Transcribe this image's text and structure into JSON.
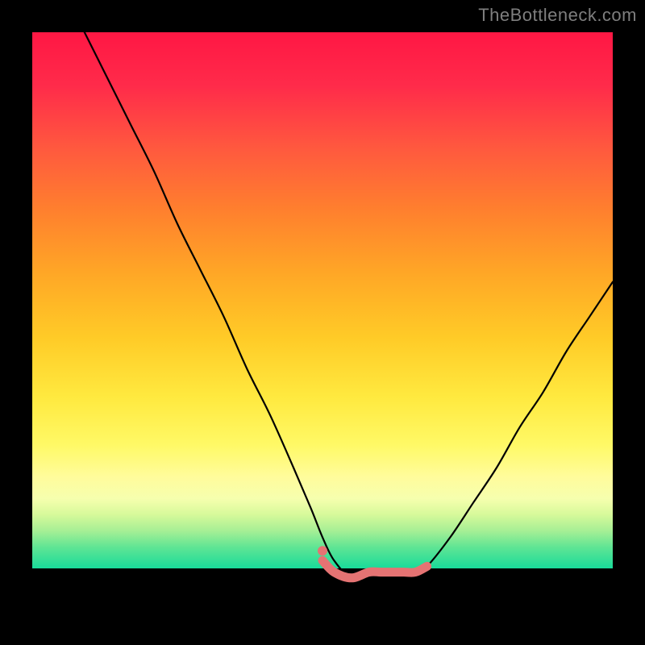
{
  "watermark": "TheBottleneck.com",
  "colors": {
    "frame": "#000000",
    "curve_main": "#000000",
    "curve_accent": "#e57373",
    "watermark": "#7e7e7e"
  },
  "chart_data": {
    "type": "line",
    "title": "",
    "xlabel": "",
    "ylabel": "",
    "xlim": [
      0,
      100
    ],
    "ylim": [
      0,
      100
    ],
    "grid": false,
    "legend": false,
    "note": "No tick labels visible. x/y are in percent of plot width/height (0,0 = bottom-left). Values read off plotted points.",
    "series": [
      {
        "name": "primary-curve",
        "color": "#000000",
        "x": [
          9,
          13,
          17,
          21,
          25,
          29,
          33,
          37,
          41,
          45,
          48,
          50,
          52,
          55,
          58,
          60,
          62,
          64,
          66,
          68,
          72,
          76,
          80,
          84,
          88,
          92,
          96,
          100
        ],
        "y": [
          100,
          92,
          84,
          76,
          67,
          59,
          51,
          42,
          34,
          25,
          18,
          13,
          9,
          6,
          7,
          7,
          7,
          7,
          7,
          8,
          13,
          19,
          25,
          32,
          38,
          45,
          51,
          57
        ]
      },
      {
        "name": "accent-segment",
        "color": "#e57373",
        "x": [
          50,
          52,
          55,
          58,
          60,
          62,
          64,
          66,
          68
        ],
        "y": [
          9,
          7,
          6,
          7,
          7,
          7,
          7,
          7,
          8
        ]
      }
    ]
  }
}
